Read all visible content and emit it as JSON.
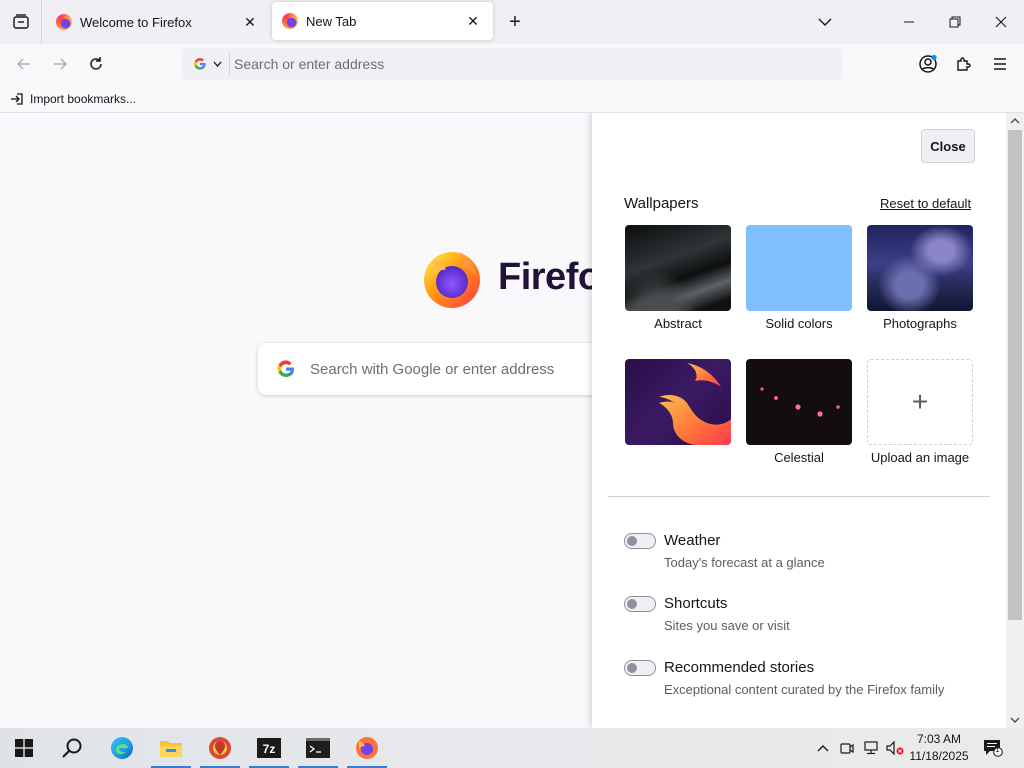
{
  "tabs": [
    {
      "label": "Welcome to Firefox"
    },
    {
      "label": "New Tab"
    }
  ],
  "urlbar": {
    "placeholder": "Search or enter address"
  },
  "bookmarks": {
    "import_label": "Import bookmarks..."
  },
  "newtab": {
    "brand": "Firefox",
    "search_placeholder": "Search with Google or enter address"
  },
  "customize": {
    "close_label": "Close",
    "wallpapers_heading": "Wallpapers",
    "reset_label": "Reset to default",
    "wallpapers": [
      {
        "label": "Abstract"
      },
      {
        "label": "Solid colors"
      },
      {
        "label": "Photographs"
      },
      {
        "label": ""
      },
      {
        "label": "Celestial"
      },
      {
        "label": "Upload an image"
      }
    ],
    "options": [
      {
        "title": "Weather",
        "desc": "Today's forecast at a glance",
        "enabled": false
      },
      {
        "title": "Shortcuts",
        "desc": "Sites you save or visit",
        "enabled": false
      },
      {
        "title": "Recommended stories",
        "desc": "Exceptional content curated by the Firefox family",
        "enabled": false
      }
    ]
  },
  "taskbar": {
    "time": "7:03 AM",
    "date": "11/18/2025",
    "notification_count": "1"
  },
  "colors": {
    "accent": "#0061e0",
    "solid_wallpaper": "#80bfff",
    "brand_text": "#20123a"
  }
}
